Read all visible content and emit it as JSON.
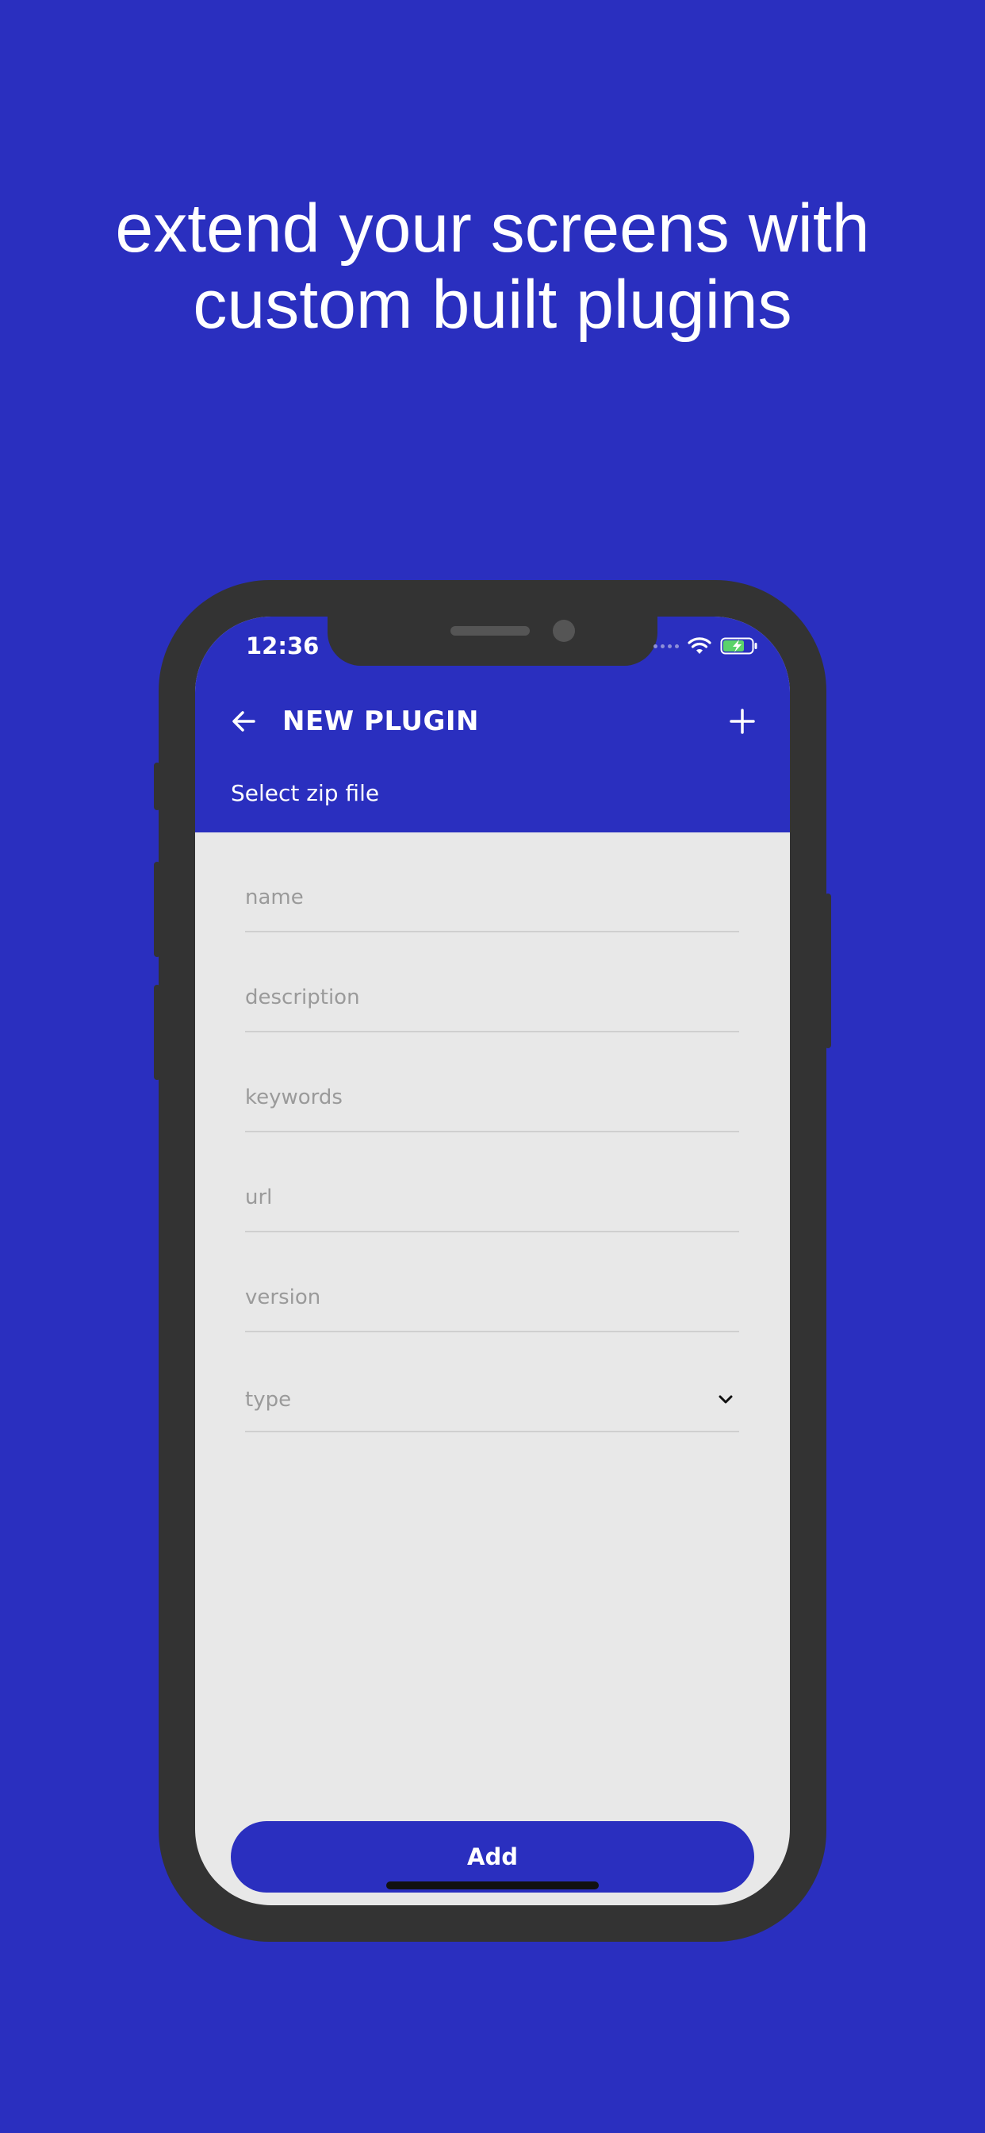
{
  "headline": {
    "line1": "extend your screens with",
    "line2": "custom built plugins"
  },
  "status_bar": {
    "time": "12:36",
    "icons": [
      "signal-dots-icon",
      "wifi-icon",
      "battery-charging-icon"
    ]
  },
  "app_bar": {
    "title": "NEW PLUGIN",
    "back_icon": "arrow-left-icon",
    "action_icon": "plus-icon",
    "subtitle_link": "Select zip file"
  },
  "form": {
    "name": {
      "placeholder": "name",
      "value": ""
    },
    "description": {
      "placeholder": "description",
      "value": ""
    },
    "keywords": {
      "placeholder": "keywords",
      "value": ""
    },
    "url": {
      "placeholder": "url",
      "value": ""
    },
    "version": {
      "placeholder": "version",
      "value": ""
    },
    "type": {
      "placeholder": "type",
      "icon": "chevron-down-icon"
    }
  },
  "add_button": {
    "label": "Add"
  },
  "colors": {
    "background": "#2a2fbf",
    "accent": "#2a2fbf",
    "phone_frame": "#333333",
    "screen_bg": "#e8e8e8",
    "battery_fill": "#5bd36a"
  }
}
